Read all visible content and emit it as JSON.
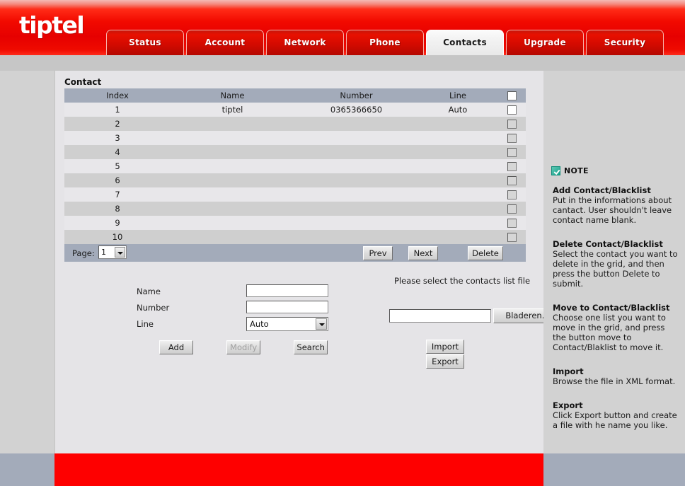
{
  "header": {
    "logo": "tiptel",
    "tabs": [
      {
        "label": "Status",
        "active": false
      },
      {
        "label": "Account",
        "active": false
      },
      {
        "label": "Network",
        "active": false
      },
      {
        "label": "Phone",
        "active": false
      },
      {
        "label": "Contacts",
        "active": true
      },
      {
        "label": "Upgrade",
        "active": false
      },
      {
        "label": "Security",
        "active": false
      }
    ]
  },
  "content": {
    "panel_title": "Contact",
    "grid": {
      "columns": [
        "Index",
        "Name",
        "Number",
        "Line",
        ""
      ],
      "rows": [
        {
          "index": "1",
          "name": "tiptel",
          "number": "0365366650",
          "line": "Auto",
          "checked": false
        },
        {
          "index": "2",
          "name": "",
          "number": "",
          "line": "",
          "checked": false
        },
        {
          "index": "3",
          "name": "",
          "number": "",
          "line": "",
          "checked": false
        },
        {
          "index": "4",
          "name": "",
          "number": "",
          "line": "",
          "checked": false
        },
        {
          "index": "5",
          "name": "",
          "number": "",
          "line": "",
          "checked": false
        },
        {
          "index": "6",
          "name": "",
          "number": "",
          "line": "",
          "checked": false
        },
        {
          "index": "7",
          "name": "",
          "number": "",
          "line": "",
          "checked": false
        },
        {
          "index": "8",
          "name": "",
          "number": "",
          "line": "",
          "checked": false
        },
        {
          "index": "9",
          "name": "",
          "number": "",
          "line": "",
          "checked": false
        },
        {
          "index": "10",
          "name": "",
          "number": "",
          "line": "",
          "checked": false
        }
      ]
    },
    "pager": {
      "page_label": "Page:",
      "page_value": "1",
      "prev_label": "Prev",
      "next_label": "Next",
      "delete_label": "Delete"
    },
    "form": {
      "name_label": "Name",
      "name_value": "",
      "number_label": "Number",
      "number_value": "",
      "line_label": "Line",
      "line_value": "Auto",
      "add_label": "Add",
      "modify_label": "Modify",
      "search_label": "Search"
    },
    "import_export": {
      "title": "Please select the contacts list file",
      "file_value": "",
      "browse_label": "Bladeren...",
      "import_label": "Import",
      "export_label": "Export"
    }
  },
  "note": {
    "heading": "NOTE",
    "blocks": [
      {
        "title": "Add Contact/Blacklist",
        "text": "Put in the informations about cantact. User shouldn't leave contact name blank."
      },
      {
        "title": "Delete Contact/Blacklist",
        "text": "Select the contact you want to delete in the grid, and then press the button Delete to submit."
      },
      {
        "title": "Move to Contact/Blacklist",
        "text": "Choose one list you want to move in the grid, and press the button move to Contact/Blaklist to move it."
      },
      {
        "title": "Import",
        "text": "Browse the file in XML format."
      },
      {
        "title": "Export",
        "text": "Click Export button and create a file with he name you like."
      }
    ]
  }
}
